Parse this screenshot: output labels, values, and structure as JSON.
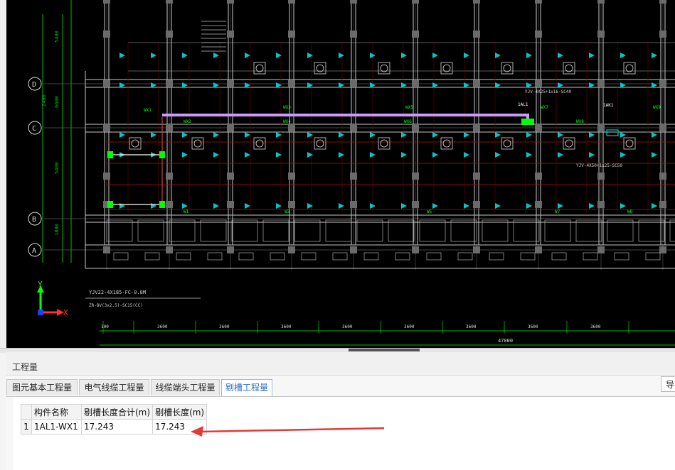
{
  "window": {
    "panel_title": "工程量",
    "export_label": "导"
  },
  "tabs": [
    {
      "label": "图元基本工程量",
      "active": false
    },
    {
      "label": "电气线缆工程量",
      "active": false
    },
    {
      "label": "线缆端头工程量",
      "active": false
    },
    {
      "label": "剔槽工程量",
      "active": true
    }
  ],
  "table": {
    "headers": [
      "构件名称",
      "剔槽长度合计(m)",
      "剔槽长度(m)"
    ],
    "rows": [
      {
        "index": "1",
        "name": "1AL1-WX1",
        "total": "17.243",
        "length": "17.243"
      }
    ]
  },
  "drawing": {
    "axis_labels": [
      "D",
      "C",
      "B",
      "A"
    ],
    "axis_x": "X",
    "axis_y": "Y",
    "dims_vertical": [
      "5400",
      "2400",
      "6600",
      "5400",
      "1800"
    ],
    "dims_horizontal": [
      "100",
      "3600",
      "3600",
      "3600",
      "3600",
      "3600",
      "3600",
      "3600",
      "3600"
    ],
    "total_dim": "47000",
    "notes": [
      "YJV22-4X185-FC-0.8M",
      "ZR-BV(3x2.5)-SC15(CC)",
      "YJV-4X25+1x16-SC40",
      "YJV-4X50+1x25-SC50"
    ],
    "labels_top": [
      "W1",
      "W3",
      "W5",
      "W7",
      "W8",
      "1AL1",
      "1AK1",
      "WX1",
      "WX2",
      "WX3",
      "WX4",
      "WX5",
      "WX6",
      "WX7",
      "WX8",
      "WX9"
    ],
    "colors": {
      "background": "#000000",
      "wall": "#c8c8c8",
      "grid": "#00c000",
      "cable": "#cc99ff",
      "accent": "#00ff00",
      "device": "#00c8c8"
    }
  }
}
